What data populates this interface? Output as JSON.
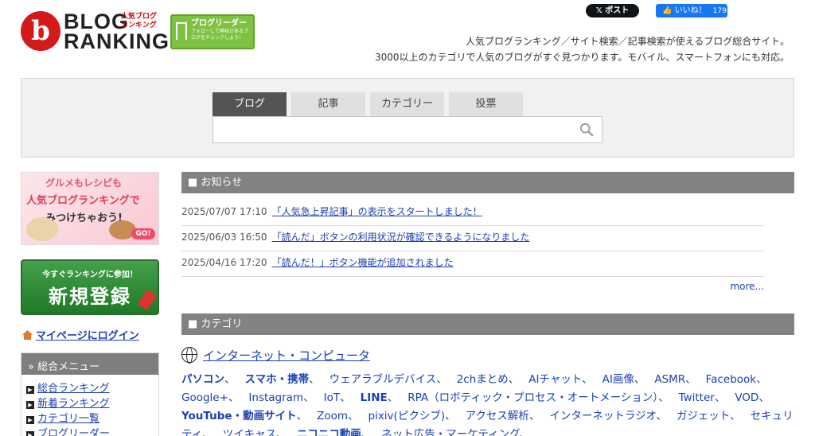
{
  "header": {
    "logo_line1": "BLOG",
    "logo_line2": "RANKING",
    "logo_ja": "人気ブログランキング",
    "logo_mark": "b",
    "reader_badge_title": "ブログリーダー",
    "reader_badge_sub": "フォローして興味があるブログをチェックしよう!",
    "x_post_label": "𝕏 ポスト",
    "fb_like_label": "👍 いいね！",
    "fb_like_count": "179",
    "tagline_1": "人気ブログランキング／サイト検索／記事検索が使えるブログ総合サイト。",
    "tagline_2": "3000以上のカテゴリで人気のブログがすぐ見つかります。モバイル、スマートフォンにも対応。"
  },
  "search": {
    "tabs": [
      "ブログ",
      "記事",
      "カテゴリー",
      "投票"
    ],
    "active_tab": 0,
    "placeholder": "",
    "value": ""
  },
  "sidebar": {
    "banner_gourmet_1": "グルメもレシピも",
    "banner_gourmet_2": "人気ブログランキングで",
    "banner_gourmet_3": "みつけちゃおう!",
    "banner_gourmet_go": "GO!",
    "register_top": "今すぐランキングに参加！",
    "register_main": "新規登録",
    "mypage_login": "マイページにログイン",
    "menu_title": "総合メニュー",
    "menu_items": [
      "総合ランキング",
      "新着ランキング",
      "カテゴリ一覧",
      "ブログリーダー"
    ]
  },
  "news": {
    "heading": "■ お知らせ",
    "items": [
      {
        "date": "2025/07/07 17:10",
        "title": "「人気急上昇記事」の表示をスタートしました！"
      },
      {
        "date": "2025/06/03 16:50",
        "title": "「読んだ」ボタンの利用状況が確認できるようになりました"
      },
      {
        "date": "2025/04/16 17:20",
        "title": "「読んだ！」ボタン機能が追加されました"
      }
    ],
    "more": "more..."
  },
  "category": {
    "heading": "■ カテゴリ",
    "title": "インターネット・コンピュータ",
    "links": [
      {
        "label": "パソコン",
        "bold": true
      },
      {
        "label": "スマホ・携帯",
        "bold": true
      },
      {
        "label": "ウェアラブルデバイス",
        "bold": false
      },
      {
        "label": "2chまとめ",
        "bold": false
      },
      {
        "label": "AIチャット",
        "bold": false
      },
      {
        "label": "AI画像",
        "bold": false
      },
      {
        "label": "ASMR",
        "bold": false
      },
      {
        "label": "Facebook",
        "bold": false
      },
      {
        "label": "Google+",
        "bold": false
      },
      {
        "label": "Instagram",
        "bold": false
      },
      {
        "label": "IoT",
        "bold": false
      },
      {
        "label": "LINE",
        "bold": true
      },
      {
        "label": "RPA（ロボティック・プロセス・オートメーション）",
        "bold": false
      },
      {
        "label": "Twitter",
        "bold": false
      },
      {
        "label": "VOD",
        "bold": false
      },
      {
        "label": "YouTube・動画サイト",
        "bold": true
      },
      {
        "label": "Zoom",
        "bold": false
      },
      {
        "label": "pixiv(ピクシブ)",
        "bold": false
      },
      {
        "label": "アクセス解析",
        "bold": false
      },
      {
        "label": "インターネットラジオ",
        "bold": false
      },
      {
        "label": "ガジェット",
        "bold": false
      },
      {
        "label": "セキュリティ",
        "bold": false
      },
      {
        "label": "ツイキャス",
        "bold": false
      },
      {
        "label": "ニコニコ動画",
        "bold": true
      },
      {
        "label": "ネット広告・マーケティング",
        "bold": false
      }
    ]
  },
  "colors": {
    "link": "#1a3fb3",
    "section_header": "#828282",
    "logo_red": "#d21a1a",
    "reader_green": "#7dc241"
  }
}
